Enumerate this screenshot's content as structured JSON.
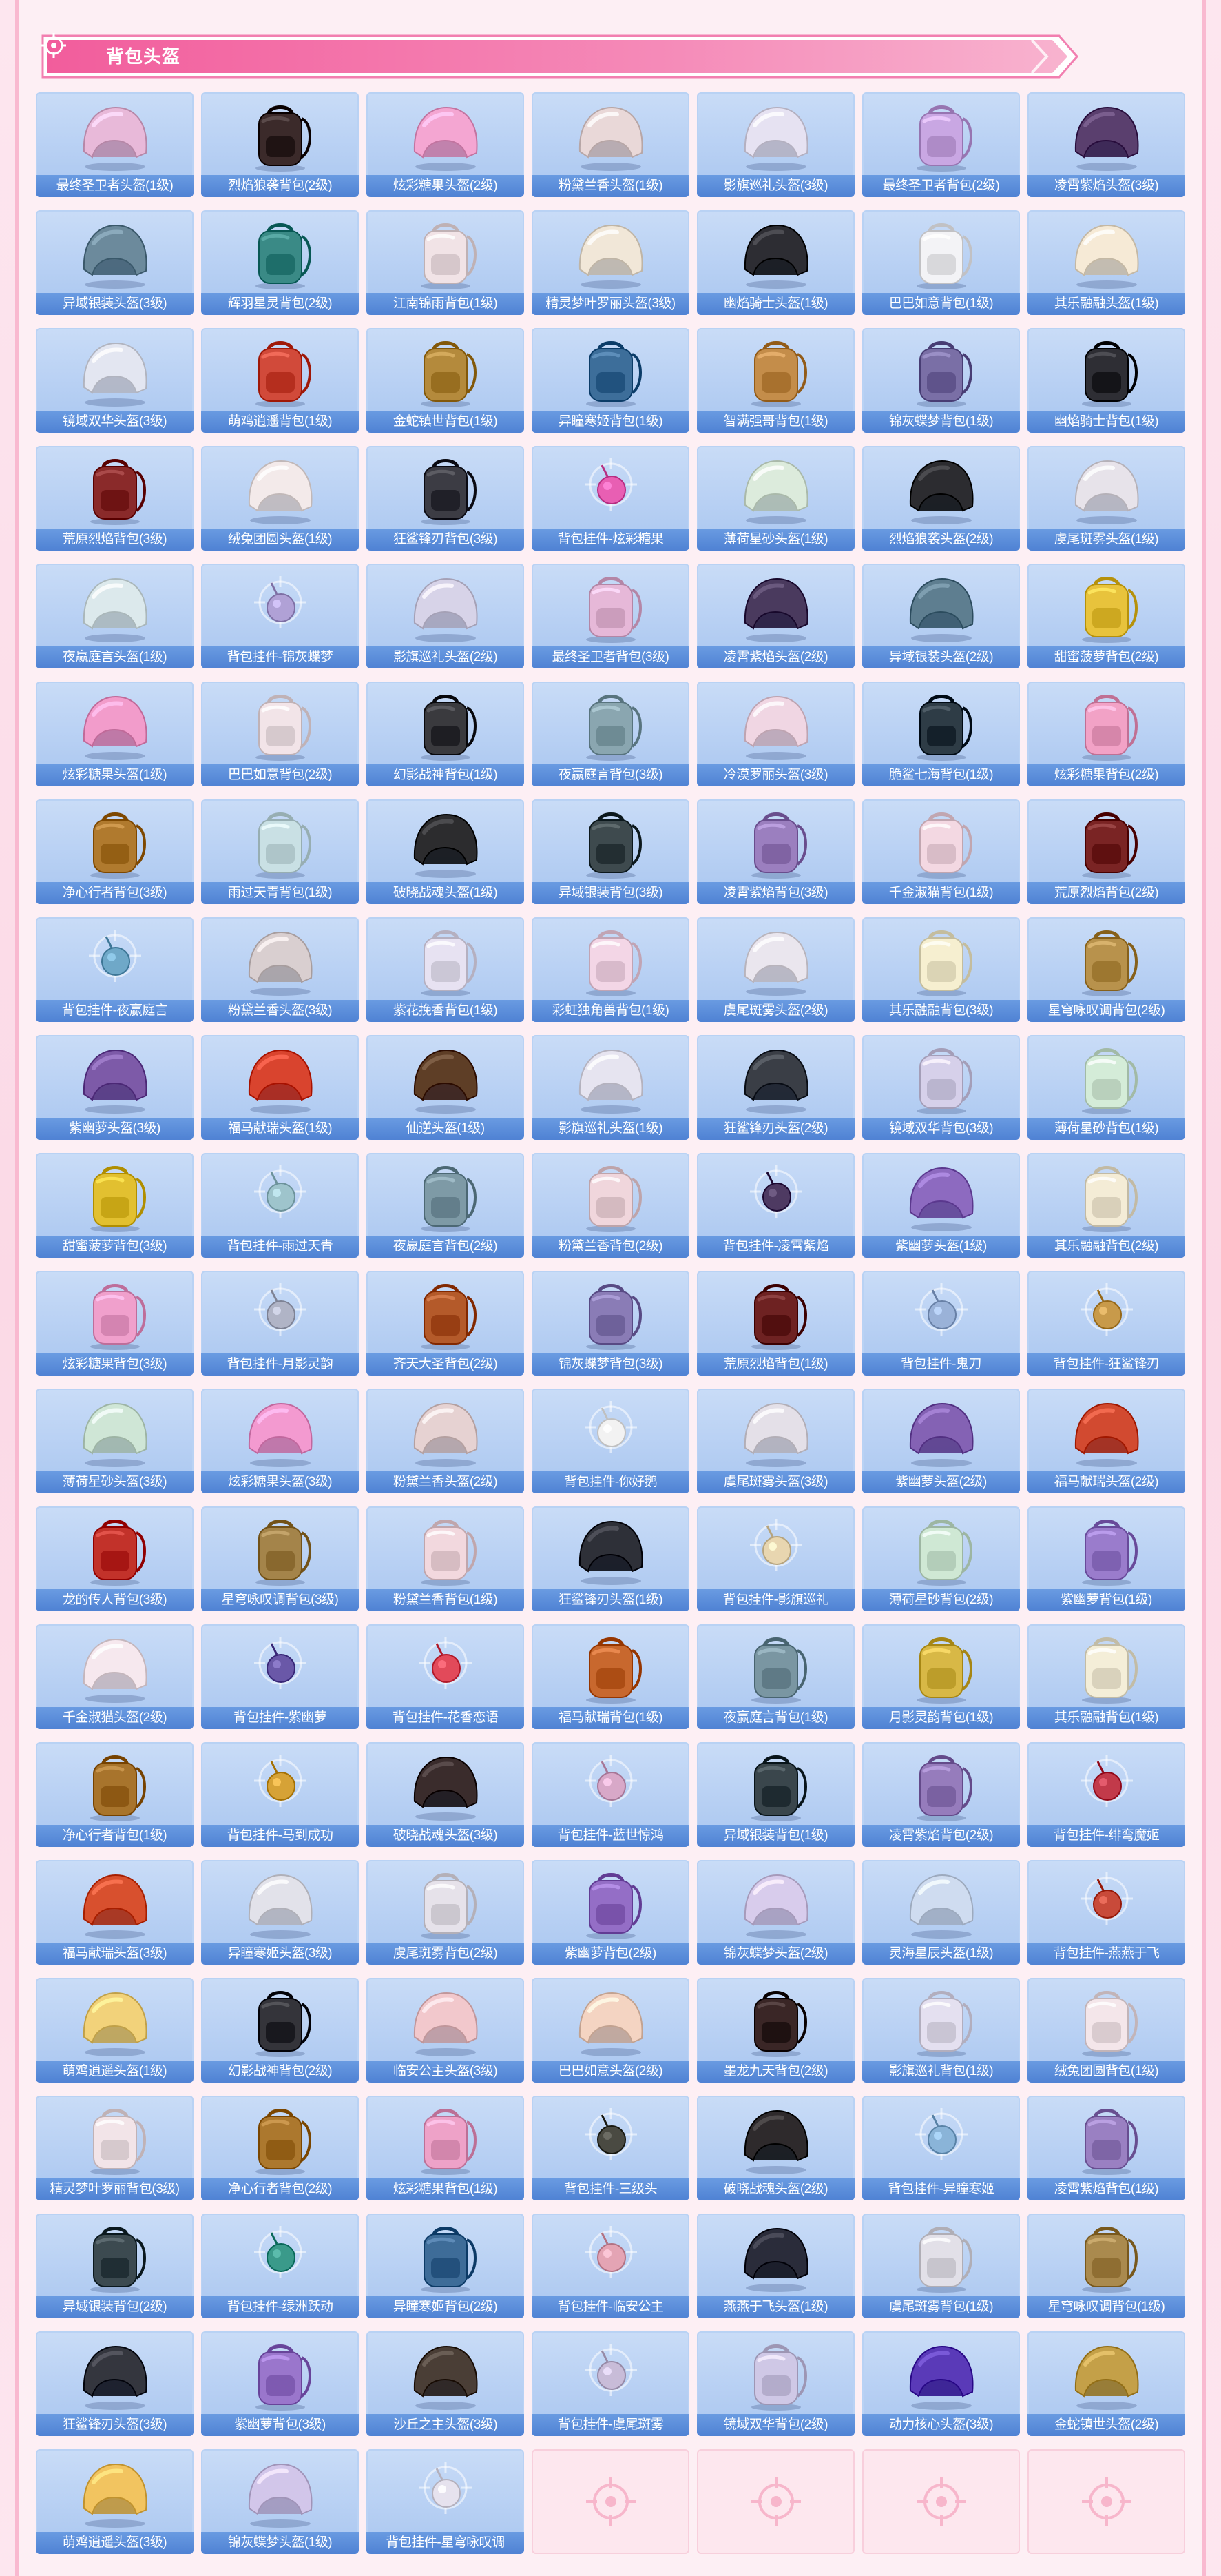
{
  "section": {
    "title": "背包头盔",
    "accent": "#f26fa6",
    "card_bg": "#a9c6f0",
    "empty_bg": "#fde7ee"
  },
  "items": [
    {
      "label": "最终圣卫者头盔(1级)",
      "icon": "helmet-icon",
      "color": "#e8b9d9"
    },
    {
      "label": "烈焰狼袭背包(2级)",
      "icon": "backpack-icon",
      "color": "#3b2a2a"
    },
    {
      "label": "炫彩糖果头盔(2级)",
      "icon": "helmet-icon",
      "color": "#f4a6d2"
    },
    {
      "label": "粉黛兰香头盔(1级)",
      "icon": "helmet-icon",
      "color": "#e9d8d8"
    },
    {
      "label": "影旗巡礼头盔(3级)",
      "icon": "helmet-icon",
      "color": "#e6e2f2"
    },
    {
      "label": "最终圣卫者背包(2级)",
      "icon": "backpack-icon",
      "color": "#c9a7e3"
    },
    {
      "label": "凌霄紫焰头盔(3级)",
      "icon": "helmet-icon",
      "color": "#5a3f6e"
    },
    {
      "label": "异域银装头盔(3级)",
      "icon": "helmet-icon",
      "color": "#6c8a9c"
    },
    {
      "label": "辉羽星灵背包(2级)",
      "icon": "backpack-icon",
      "color": "#3a8a86"
    },
    {
      "label": "江南锦雨背包(1级)",
      "icon": "backpack-icon",
      "color": "#f1e3e6"
    },
    {
      "label": "精灵梦叶罗丽头盔(3级)",
      "icon": "helmet-icon",
      "color": "#f1e7d8"
    },
    {
      "label": "幽焰骑士头盔(1级)",
      "icon": "helmet-icon",
      "color": "#2d2d33"
    },
    {
      "label": "巴巴如意背包(1级)",
      "icon": "backpack-icon",
      "color": "#f3f3f6"
    },
    {
      "label": "其乐融融头盔(1级)",
      "icon": "helmet-icon",
      "color": "#f6ead6"
    },
    {
      "label": "镜域双华头盔(3级)",
      "icon": "helmet-icon",
      "color": "#e3e6f1"
    },
    {
      "label": "萌鸡逍遥背包(1级)",
      "icon": "backpack-icon",
      "color": "#d14a3a"
    },
    {
      "label": "金蛇镇世背包(1级)",
      "icon": "backpack-icon",
      "color": "#b48a3c"
    },
    {
      "label": "异瞳寒姬背包(1级)",
      "icon": "backpack-icon",
      "color": "#3d6e9a"
    },
    {
      "label": "智满强哥背包(1级)",
      "icon": "backpack-icon",
      "color": "#c48d4a"
    },
    {
      "label": "锦灰蝶梦背包(1级)",
      "icon": "backpack-icon",
      "color": "#7a6fa6"
    },
    {
      "label": "幽焰骑士背包(1级)",
      "icon": "backpack-icon",
      "color": "#2e2e34"
    },
    {
      "label": "荒原烈焰背包(3级)",
      "icon": "backpack-icon",
      "color": "#8a2a2a"
    },
    {
      "label": "绒兔团圆头盔(1级)",
      "icon": "helmet-icon",
      "color": "#f3eaea"
    },
    {
      "label": "狂鲨锋刃背包(3级)",
      "icon": "backpack-icon",
      "color": "#3c3c44"
    },
    {
      "label": "背包挂件-炫彩糖果",
      "icon": "charm-icon",
      "color": "#e85fb3"
    },
    {
      "label": "薄荷星砂头盔(1级)",
      "icon": "helmet-icon",
      "color": "#dcebdc"
    },
    {
      "label": "烈焰狼袭头盔(2级)",
      "icon": "helmet-icon",
      "color": "#2c2c30"
    },
    {
      "label": "虞尾斑雾头盔(1级)",
      "icon": "helmet-icon",
      "color": "#e7e3ea"
    },
    {
      "label": "夜赢庭言头盔(1级)",
      "icon": "helmet-icon",
      "color": "#dce9ec"
    },
    {
      "label": "背包挂件-锦灰蝶梦",
      "icon": "charm-icon",
      "color": "#b0a1d6"
    },
    {
      "label": "影旗巡礼头盔(2级)",
      "icon": "helmet-icon",
      "color": "#d7d3e8"
    },
    {
      "label": "最终圣卫者背包(3级)",
      "icon": "backpack-icon",
      "color": "#e6b8d8"
    },
    {
      "label": "凌霄紫焰头盔(2级)",
      "icon": "helmet-icon",
      "color": "#4a3a5e"
    },
    {
      "label": "异域银装头盔(2级)",
      "icon": "helmet-icon",
      "color": "#5e7e90"
    },
    {
      "label": "甜蜜菠萝背包(2级)",
      "icon": "backpack-icon",
      "color": "#e8c33c"
    },
    {
      "label": "炫彩糖果头盔(1级)",
      "icon": "helmet-icon",
      "color": "#f29ccb"
    },
    {
      "label": "巴巴如意背包(2级)",
      "icon": "backpack-icon",
      "color": "#f2e4e8"
    },
    {
      "label": "幻影战神背包(1级)",
      "icon": "backpack-icon",
      "color": "#3a3a3e"
    },
    {
      "label": "夜赢庭言背包(3级)",
      "icon": "backpack-icon",
      "color": "#8aa6b0"
    },
    {
      "label": "冷漠罗丽头盔(3级)",
      "icon": "helmet-icon",
      "color": "#f0d6e3"
    },
    {
      "label": "脆鲨七海背包(1级)",
      "icon": "backpack-icon",
      "color": "#2e3c46"
    },
    {
      "label": "炫彩糖果背包(2级)",
      "icon": "backpack-icon",
      "color": "#f2a2c6"
    },
    {
      "label": "净心行者背包(3级)",
      "icon": "backpack-icon",
      "color": "#b07a2e"
    },
    {
      "label": "雨过天青背包(1级)",
      "icon": "backpack-icon",
      "color": "#c9e0e4"
    },
    {
      "label": "破晓战魂头盔(1级)",
      "icon": "helmet-icon",
      "color": "#2c2c2e"
    },
    {
      "label": "异域银装背包(3级)",
      "icon": "backpack-icon",
      "color": "#3e4a4e"
    },
    {
      "label": "凌霄紫焰背包(3级)",
      "icon": "backpack-icon",
      "color": "#9b7fbf"
    },
    {
      "label": "千金淑猫背包(1级)",
      "icon": "backpack-icon",
      "color": "#f3d8e2"
    },
    {
      "label": "荒原烈焰背包(2级)",
      "icon": "backpack-icon",
      "color": "#7a2424"
    },
    {
      "label": "背包挂件-夜赢庭言",
      "icon": "charm-icon",
      "color": "#6fa8c8"
    },
    {
      "label": "粉黛兰香头盔(3级)",
      "icon": "helmet-icon",
      "color": "#d9cfd0"
    },
    {
      "label": "紫花挽香背包(1级)",
      "icon": "backpack-icon",
      "color": "#e7e2f2"
    },
    {
      "label": "彩虹独角兽背包(1级)",
      "icon": "backpack-icon",
      "color": "#f3d6e6"
    },
    {
      "label": "虞尾斑雾头盔(2级)",
      "icon": "helmet-icon",
      "color": "#eae6ee"
    },
    {
      "label": "其乐融融背包(3级)",
      "icon": "backpack-icon",
      "color": "#f6efd0"
    },
    {
      "label": "星穹咏叹调背包(2级)",
      "icon": "backpack-icon",
      "color": "#b8924c"
    },
    {
      "label": "紫幽萝头盔(3级)",
      "icon": "helmet-icon",
      "color": "#7d5aa8"
    },
    {
      "label": "福马献瑞头盔(1级)",
      "icon": "helmet-icon",
      "color": "#d9442e"
    },
    {
      "label": "仙逆头盔(1级)",
      "icon": "helmet-icon",
      "color": "#5e3e26"
    },
    {
      "label": "影旗巡礼头盔(1级)",
      "icon": "helmet-icon",
      "color": "#e6e4f0"
    },
    {
      "label": "狂鲨锋刃头盔(2级)",
      "icon": "helmet-icon",
      "color": "#3a3e46"
    },
    {
      "label": "镜域双华背包(3级)",
      "icon": "backpack-icon",
      "color": "#d6d0ea"
    },
    {
      "label": "薄荷星砂背包(1级)",
      "icon": "backpack-icon",
      "color": "#d4ecd8"
    },
    {
      "label": "甜蜜菠萝背包(3级)",
      "icon": "backpack-icon",
      "color": "#e2c030"
    },
    {
      "label": "背包挂件-雨过天青",
      "icon": "charm-icon",
      "color": "#9ec4cc"
    },
    {
      "label": "夜赢庭言背包(2级)",
      "icon": "backpack-icon",
      "color": "#7e9aa6"
    },
    {
      "label": "粉黛兰香背包(2级)",
      "icon": "backpack-icon",
      "color": "#f0d6dc"
    },
    {
      "label": "背包挂件-凌霄紫焰",
      "icon": "charm-icon",
      "color": "#4e3a62"
    },
    {
      "label": "紫幽萝头盔(1级)",
      "icon": "helmet-icon",
      "color": "#8d6ac0"
    },
    {
      "label": "其乐融融背包(2级)",
      "icon": "backpack-icon",
      "color": "#f4ecd6"
    },
    {
      "label": "炫彩糖果背包(3级)",
      "icon": "backpack-icon",
      "color": "#f0a0cc"
    },
    {
      "label": "背包挂件-月影灵韵",
      "icon": "charm-icon",
      "color": "#b0b4c6"
    },
    {
      "label": "齐天大圣背包(2级)",
      "icon": "backpack-icon",
      "color": "#b45a2a"
    },
    {
      "label": "锦灰蝶梦背包(3级)",
      "icon": "backpack-icon",
      "color": "#8a7cb6"
    },
    {
      "label": "荒原烈焰背包(1级)",
      "icon": "backpack-icon",
      "color": "#6e2222"
    },
    {
      "label": "背包挂件-鬼刀",
      "icon": "charm-icon",
      "color": "#9ab2d8"
    },
    {
      "label": "背包挂件-狂鲨锋刃",
      "icon": "charm-icon",
      "color": "#c89a4a"
    },
    {
      "label": "薄荷星砂头盔(3级)",
      "icon": "helmet-icon",
      "color": "#cfe6d6"
    },
    {
      "label": "炫彩糖果头盔(3级)",
      "icon": "helmet-icon",
      "color": "#f39ad0"
    },
    {
      "label": "粉黛兰香头盔(2级)",
      "icon": "helmet-icon",
      "color": "#e6d2d2"
    },
    {
      "label": "背包挂件-你好鹅",
      "icon": "charm-icon",
      "color": "#f2f2f2"
    },
    {
      "label": "虞尾斑雾头盔(3级)",
      "icon": "helmet-icon",
      "color": "#e4e0e8"
    },
    {
      "label": "紫幽萝头盔(2级)",
      "icon": "helmet-icon",
      "color": "#8462b4"
    },
    {
      "label": "福马献瑞头盔(2级)",
      "icon": "helmet-icon",
      "color": "#d24a30"
    },
    {
      "label": "龙的传人背包(3级)",
      "icon": "backpack-icon",
      "color": "#c2322a"
    },
    {
      "label": "星穹咏叹调背包(3级)",
      "icon": "backpack-icon",
      "color": "#a4844a"
    },
    {
      "label": "粉黛兰香背包(1级)",
      "icon": "backpack-icon",
      "color": "#f2d8de"
    },
    {
      "label": "狂鲨锋刃头盔(1级)",
      "icon": "helmet-icon",
      "color": "#2e3038"
    },
    {
      "label": "背包挂件-影旗巡礼",
      "icon": "charm-icon",
      "color": "#e8d6b0"
    },
    {
      "label": "薄荷星砂背包(2级)",
      "icon": "backpack-icon",
      "color": "#cfe8d4"
    },
    {
      "label": "紫幽萝背包(1级)",
      "icon": "backpack-icon",
      "color": "#9a7ccc"
    },
    {
      "label": "千金淑猫头盔(2级)",
      "icon": "helmet-icon",
      "color": "#f6e8ee"
    },
    {
      "label": "背包挂件-紫幽萝",
      "icon": "charm-icon",
      "color": "#6a58a8"
    },
    {
      "label": "背包挂件-花香恋语",
      "icon": "charm-icon",
      "color": "#e24a5a"
    },
    {
      "label": "福马献瑞背包(1级)",
      "icon": "backpack-icon",
      "color": "#c8682e"
    },
    {
      "label": "夜赢庭言背包(1级)",
      "icon": "backpack-icon",
      "color": "#7a96a2"
    },
    {
      "label": "月影灵韵背包(1级)",
      "icon": "backpack-icon",
      "color": "#d8b846"
    },
    {
      "label": "其乐融融背包(1级)",
      "icon": "backpack-icon",
      "color": "#f4eed8"
    },
    {
      "label": "净心行者背包(1级)",
      "icon": "backpack-icon",
      "color": "#a8742c"
    },
    {
      "label": "背包挂件-马到成功",
      "icon": "charm-icon",
      "color": "#d6a236"
    },
    {
      "label": "破晓战魂头盔(3级)",
      "icon": "helmet-icon",
      "color": "#3a2c2c"
    },
    {
      "label": "背包挂件-蓝世惊鸿",
      "icon": "charm-icon",
      "color": "#d8a8c8"
    },
    {
      "label": "异域银装背包(1级)",
      "icon": "backpack-icon",
      "color": "#3a464c"
    },
    {
      "label": "凌霄紫焰背包(2级)",
      "icon": "backpack-icon",
      "color": "#967cbc"
    },
    {
      "label": "背包挂件-绯弯魔姬",
      "icon": "charm-icon",
      "color": "#c23a4a"
    },
    {
      "label": "福马献瑞头盔(3级)",
      "icon": "helmet-icon",
      "color": "#d8502e"
    },
    {
      "label": "异瞳寒姬头盔(3级)",
      "icon": "helmet-icon",
      "color": "#e2e2ea"
    },
    {
      "label": "虞尾斑雾背包(2级)",
      "icon": "backpack-icon",
      "color": "#e6e2ea"
    },
    {
      "label": "紫幽萝背包(2级)",
      "icon": "backpack-icon",
      "color": "#946ec6"
    },
    {
      "label": "锦灰蝶梦头盔(2级)",
      "icon": "helmet-icon",
      "color": "#d8ccec"
    },
    {
      "label": "灵海星辰头盔(1级)",
      "icon": "helmet-icon",
      "color": "#cfdcf0"
    },
    {
      "label": "背包挂件-燕燕于飞",
      "icon": "charm-icon",
      "color": "#c84a3a"
    },
    {
      "label": "萌鸡逍遥头盔(1级)",
      "icon": "helmet-icon",
      "color": "#f2d27a"
    },
    {
      "label": "幻影战神背包(2级)",
      "icon": "backpack-icon",
      "color": "#34343a"
    },
    {
      "label": "临安公主头盔(3级)",
      "icon": "helmet-icon",
      "color": "#f2c8cc"
    },
    {
      "label": "巴巴如意头盔(2级)",
      "icon": "helmet-icon",
      "color": "#f4d4c2"
    },
    {
      "label": "墨龙九天背包(2级)",
      "icon": "backpack-icon",
      "color": "#3a2626"
    },
    {
      "label": "影旗巡礼背包(1级)",
      "icon": "backpack-icon",
      "color": "#e4e0f0"
    },
    {
      "label": "绒兔团圆背包(1级)",
      "icon": "backpack-icon",
      "color": "#f4e6ea"
    },
    {
      "label": "精灵梦叶罗丽背包(3级)",
      "icon": "backpack-icon",
      "color": "#f2e4e8"
    },
    {
      "label": "净心行者背包(2级)",
      "icon": "backpack-icon",
      "color": "#ac782e"
    },
    {
      "label": "炫彩糖果背包(1级)",
      "icon": "backpack-icon",
      "color": "#eea2c8"
    },
    {
      "label": "背包挂件-三级头",
      "icon": "charm-icon",
      "color": "#4a4a42"
    },
    {
      "label": "破晓战魂头盔(2级)",
      "icon": "helmet-icon",
      "color": "#2e2a2c"
    },
    {
      "label": "背包挂件-异瞳寒姬",
      "icon": "charm-icon",
      "color": "#8ab4d8"
    },
    {
      "label": "凌霄紫焰背包(1级)",
      "icon": "backpack-icon",
      "color": "#9a80c2"
    },
    {
      "label": "异域银装背包(2级)",
      "icon": "backpack-icon",
      "color": "#3c4a50"
    },
    {
      "label": "背包挂件-绿洲跃动",
      "icon": "charm-icon",
      "color": "#3a9a8a"
    },
    {
      "label": "异瞳寒姬背包(2级)",
      "icon": "backpack-icon",
      "color": "#3e6c98"
    },
    {
      "label": "背包挂件-临安公主",
      "icon": "charm-icon",
      "color": "#e4a4b4"
    },
    {
      "label": "燕燕于飞头盔(1级)",
      "icon": "helmet-icon",
      "color": "#2a2c3a"
    },
    {
      "label": "虞尾斑雾背包(1级)",
      "icon": "backpack-icon",
      "color": "#e2e0e8"
    },
    {
      "label": "星穹咏叹调背包(1级)",
      "icon": "backpack-icon",
      "color": "#aa8a4e"
    },
    {
      "label": "狂鲨锋刃头盔(3级)",
      "icon": "helmet-icon",
      "color": "#34363e"
    },
    {
      "label": "紫幽萝背包(3级)",
      "icon": "backpack-icon",
      "color": "#9a76cc"
    },
    {
      "label": "沙丘之主头盔(3级)",
      "icon": "helmet-icon",
      "color": "#4a3e36"
    },
    {
      "label": "背包挂件-虞尾斑雾",
      "icon": "charm-icon",
      "color": "#c8bcd8"
    },
    {
      "label": "镜域双华背包(2级)",
      "icon": "backpack-icon",
      "color": "#cfc8e6"
    },
    {
      "label": "动力核心头盔(3级)",
      "icon": "helmet-icon",
      "color": "#5a3ab8"
    },
    {
      "label": "金蛇镇世头盔(2级)",
      "icon": "helmet-icon",
      "color": "#c4a048"
    },
    {
      "label": "萌鸡逍遥头盔(3级)",
      "icon": "helmet-icon",
      "color": "#f2c460"
    },
    {
      "label": "锦灰蝶梦头盔(1级)",
      "icon": "helmet-icon",
      "color": "#d2c6ea"
    },
    {
      "label": "背包挂件-星穹咏叹调",
      "icon": "charm-icon",
      "color": "#e6e2ee"
    }
  ],
  "empty_slots": 4
}
